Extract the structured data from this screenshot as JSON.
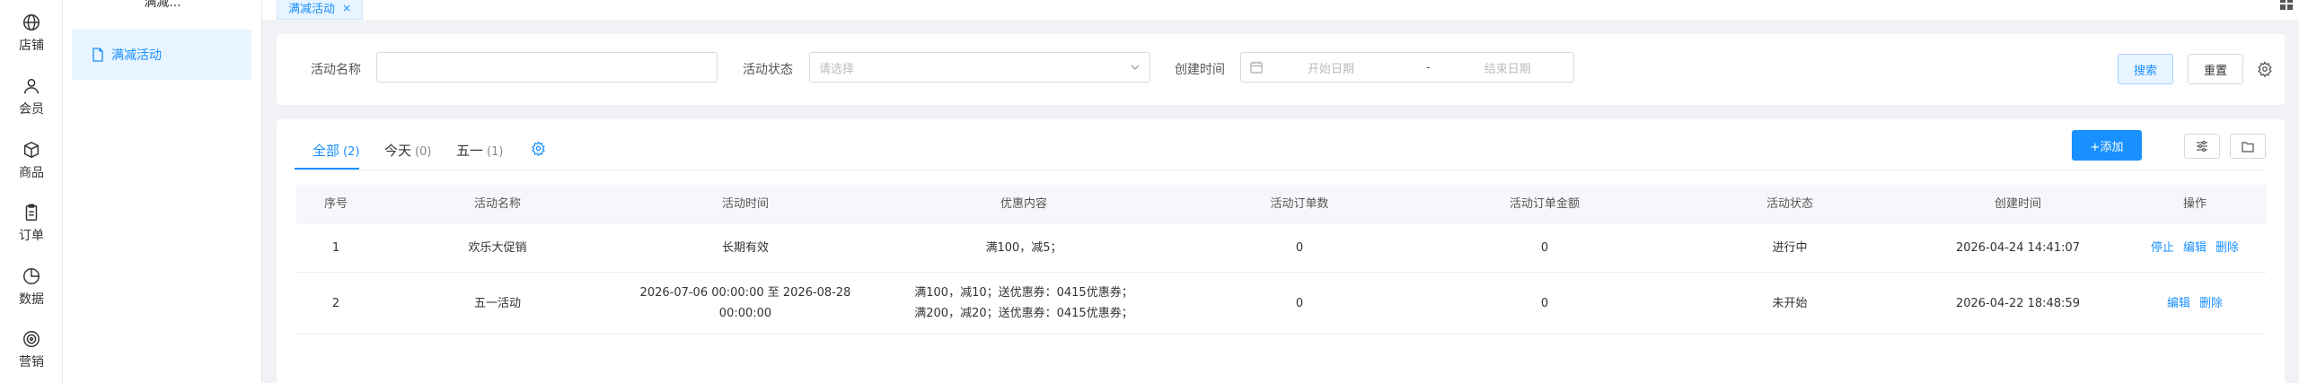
{
  "rail": {
    "items": [
      {
        "label": "店铺",
        "icon": "globe-icon"
      },
      {
        "label": "会员",
        "icon": "user-icon"
      },
      {
        "label": "商品",
        "icon": "box-icon"
      },
      {
        "label": "订单",
        "icon": "clipboard-icon"
      },
      {
        "label": "数据",
        "icon": "pie-chart-icon"
      },
      {
        "label": "营销",
        "icon": "target-icon"
      }
    ]
  },
  "submenu": {
    "title": "满减...",
    "active_item": "满减活动"
  },
  "tabbar": {
    "tab_label": "满减活动",
    "close_glyph": "×"
  },
  "search": {
    "name_label": "活动名称",
    "name_value": "",
    "status_label": "活动状态",
    "status_placeholder": "请选择",
    "created_label": "创建时间",
    "start_placeholder": "开始日期",
    "date_separator": "-",
    "end_placeholder": "结束日期",
    "search_button": "搜索",
    "reset_button": "重置"
  },
  "table": {
    "tabs": [
      {
        "label": "全部",
        "count": "(2)"
      },
      {
        "label": "今天",
        "count": "(0)"
      },
      {
        "label": "五一",
        "count": "(1)"
      }
    ],
    "add_button": "+添加",
    "columns": [
      "序号",
      "活动名称",
      "活动时间",
      "优惠内容",
      "活动订单数",
      "活动订单金额",
      "活动状态",
      "创建时间",
      "操作"
    ],
    "rows": [
      {
        "index": "1",
        "name": "欢乐大促销",
        "time_line1": "长期有效",
        "time_line2": "",
        "discount_line1": "满100，减5；",
        "discount_line2": "",
        "orders": "0",
        "amount": "0",
        "status": "进行中",
        "created": "2026-04-24 14:41:07",
        "actions": [
          "停止",
          "编辑",
          "删除"
        ]
      },
      {
        "index": "2",
        "name": "五一活动",
        "time_line1": "2026-07-06 00:00:00 至 2026-08-28",
        "time_line2": "00:00:00",
        "discount_line1": "满100，减10；送优惠券：0415优惠券；",
        "discount_line2": "满200，减20；送优惠券：0415优惠券；",
        "orders": "0",
        "amount": "0",
        "status": "未开始",
        "created": "2026-04-22 18:48:59",
        "actions": [
          "编辑",
          "删除"
        ]
      }
    ]
  },
  "colors": {
    "accent": "#1890ff",
    "active_bg": "#e8f4ff",
    "page_bg": "#f0f2f5"
  }
}
